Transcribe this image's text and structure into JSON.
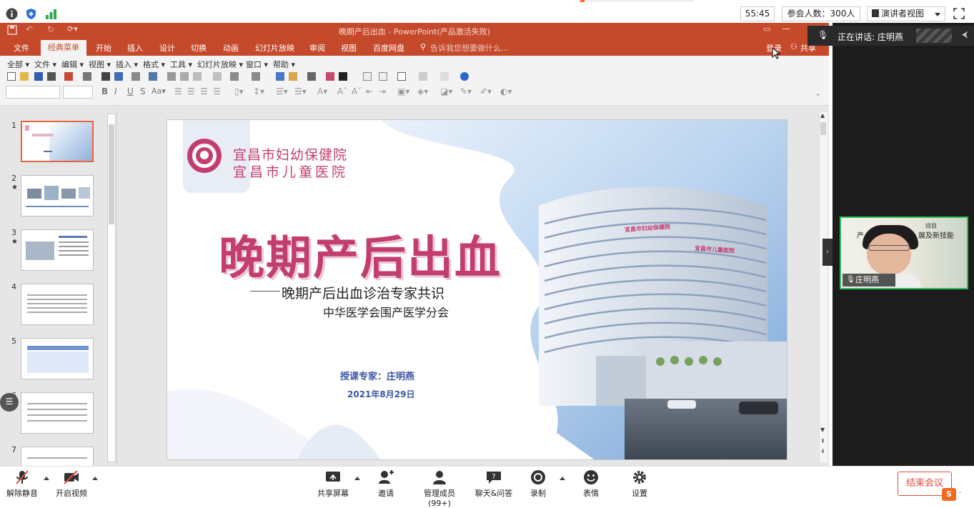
{
  "topbar": {
    "timer": "55:45",
    "participants": "参会人数：300人",
    "view_mode": "演讲者视图"
  },
  "ppt": {
    "window_title": "晚期产后出血 - PowerPoint(产品激活失败)",
    "file_tab": "文件",
    "tabs": [
      "经典菜单",
      "开始",
      "插入",
      "设计",
      "切换",
      "动画",
      "幻灯片放映",
      "审阅",
      "视图",
      "百度网盘"
    ],
    "tell_me": "告诉我您想要做什么...",
    "login": "登录",
    "share": "共享",
    "menu": [
      "全部",
      "文件",
      "编辑",
      "视图",
      "插入",
      "格式",
      "工具",
      "幻灯片放映",
      "窗口",
      "帮助"
    ],
    "slide_numbers": [
      "1",
      "2",
      "3",
      "4",
      "5",
      "6",
      "7"
    ]
  },
  "slide": {
    "hospital_line1": "宜昌市妇幼保健院",
    "hospital_line2": "宜昌市儿童医院",
    "title": "晚期产后出血",
    "subtitle": "晚期产后出血诊治专家共识",
    "org": "中华医学会围产医学分会",
    "speaker": "授课专家：庄明燕",
    "date": "2021年8月29日",
    "building_sign1": "宜昌市妇幼保健院",
    "building_sign2": "宜昌市儿童医院"
  },
  "right": {
    "speaking": "正在讲话: 庄明燕",
    "video_name": "庄明燕",
    "video_overlay1": "项目",
    "video_overlay2": "展及新技能",
    "video_overlay3": "产"
  },
  "bottombar": {
    "mute": "解除静音",
    "video": "开启视频",
    "share": "共享屏幕",
    "invite": "邀请",
    "members": "管理成员(99+)",
    "chat": "聊天&问答",
    "record": "录制",
    "reaction": "表情",
    "settings": "设置",
    "end": "结束会议"
  },
  "colors": {
    "ppt_accent": "#c5492b",
    "title_pink": "#c23e6f",
    "end_red": "#e24a3b",
    "video_border": "#2fbe5a"
  }
}
